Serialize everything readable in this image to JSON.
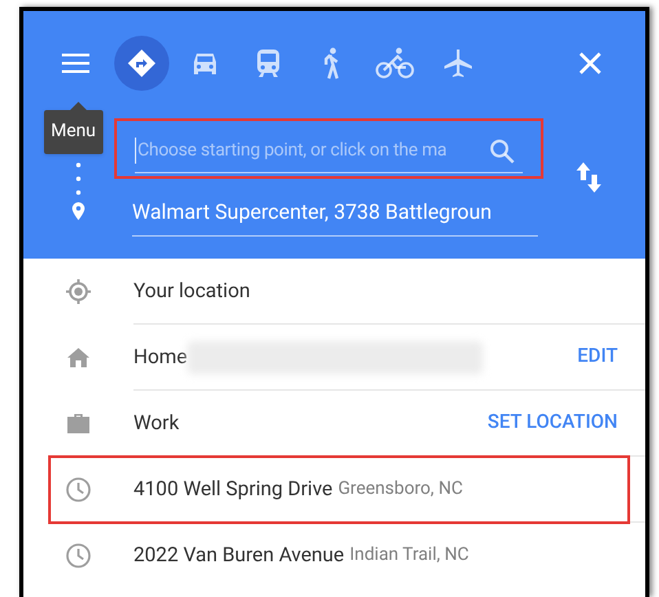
{
  "travel_modes": [
    {
      "kind": "best",
      "selected": true
    },
    {
      "kind": "car",
      "selected": false
    },
    {
      "kind": "transit",
      "selected": false
    },
    {
      "kind": "walk",
      "selected": false
    },
    {
      "kind": "bike",
      "selected": false
    },
    {
      "kind": "flight",
      "selected": false
    }
  ],
  "tooltip": "Menu",
  "start_field": {
    "placeholder": "Choose starting point, or click on the ma",
    "highlighted": true
  },
  "destination_field": {
    "value": "Walmart Supercenter, 3738 Battlegroun"
  },
  "suggestions": [
    {
      "kind": "location",
      "title": "Your location"
    },
    {
      "kind": "home",
      "title": "Home",
      "redacted": true,
      "action": "EDIT"
    },
    {
      "kind": "work",
      "title": "Work",
      "action": "SET LOCATION"
    },
    {
      "kind": "recent",
      "title": "4100 Well Spring Drive",
      "subtitle": "Greensboro, NC",
      "highlighted": true
    },
    {
      "kind": "recent",
      "title": "2022 Van Buren Avenue",
      "subtitle": "Indian Trail, NC"
    }
  ]
}
